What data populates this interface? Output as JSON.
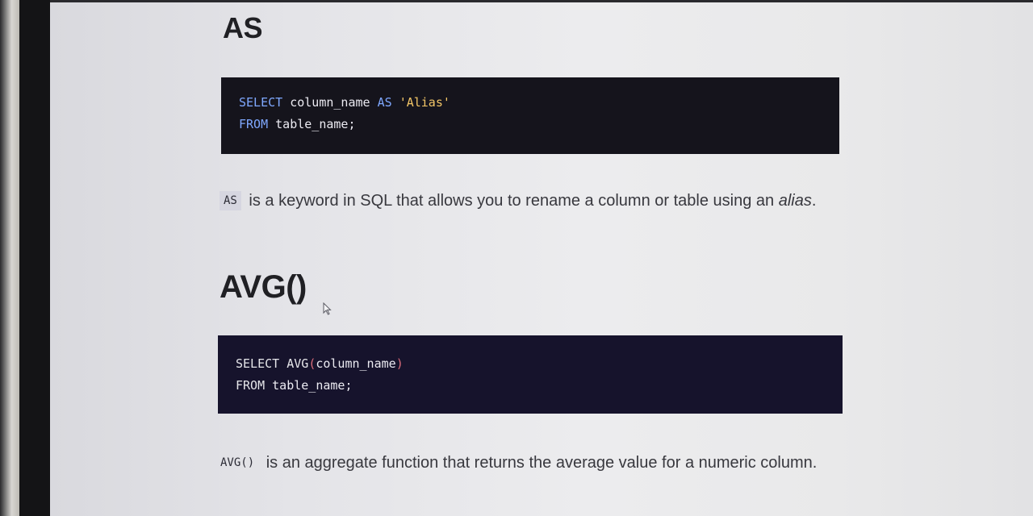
{
  "sections": [
    {
      "heading": "AS",
      "code": {
        "line1": {
          "kw1": "SELECT",
          "ident": " column_name ",
          "kw2": "AS",
          "space": " ",
          "string": "'Alias'"
        },
        "line2": {
          "kw1": "FROM",
          "rest": " table_name;"
        }
      },
      "description": {
        "code_term": "AS",
        "text_before": "is a keyword in SQL that allows you to rename a column or table using an ",
        "emphasis": "alias",
        "text_after": "."
      }
    },
    {
      "heading": "AVG()",
      "code": {
        "line1": {
          "kw1": "SELECT",
          "fn": " AVG",
          "open": "(",
          "ident": "column_name",
          "close": ")"
        },
        "line2": {
          "kw1": "FROM",
          "rest": " table_name;"
        }
      },
      "description": {
        "code_term": "AVG()",
        "text": "is an aggregate function that returns the average value for a numeric column."
      }
    }
  ],
  "colors": {
    "keyword": "#7fa8ff",
    "string": "#f3c667",
    "paren": "#d96b7a",
    "code_bg_as": "#15141c",
    "code_bg_avg": "#16132c"
  },
  "icons": {
    "cursor": "mouse-pointer-icon"
  }
}
